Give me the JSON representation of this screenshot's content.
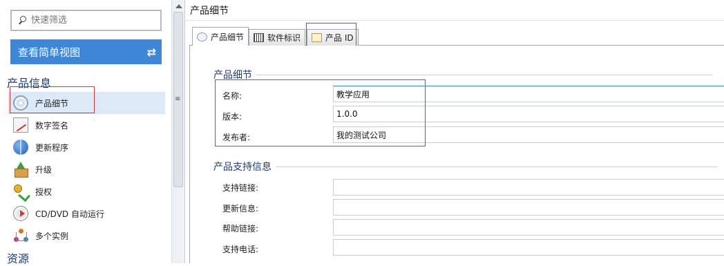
{
  "sidebar": {
    "filter_placeholder": "快速筛选",
    "simple_view_label": "查看简单视图",
    "simple_view_icon": "swap-arrows-icon",
    "section_product_info": "产品信息",
    "section_resources": "资源",
    "items": [
      {
        "label": "产品细节",
        "icon": "disc-gear-icon",
        "active": true
      },
      {
        "label": "数字签名",
        "icon": "signature-icon"
      },
      {
        "label": "更新程序",
        "icon": "globe-update-icon"
      },
      {
        "label": "升级",
        "icon": "upgrade-box-icon"
      },
      {
        "label": "授权",
        "icon": "key-license-icon"
      },
      {
        "label": "CD/DVD 自动运行",
        "icon": "cd-autorun-icon"
      },
      {
        "label": "多个实例",
        "icon": "multiple-instances-icon"
      }
    ]
  },
  "main": {
    "title": "产品细节",
    "tabs": [
      {
        "label": "产品细节",
        "icon": "disc-gear-icon",
        "active": true
      },
      {
        "label": "软件标识",
        "icon": "barcode-icon"
      },
      {
        "label": "产品 ID",
        "icon": "cd-icon"
      }
    ],
    "details_group": {
      "title": "产品细节",
      "fields": [
        {
          "label": "名称:",
          "value": "教学应用"
        },
        {
          "label": "版本:",
          "value": "1.0.0"
        },
        {
          "label": "发布者:",
          "value": "我的测试公司"
        }
      ]
    },
    "support_group": {
      "title": "产品支持信息",
      "fields": [
        {
          "label": "支持链接:",
          "value": ""
        },
        {
          "label": "更新信息:",
          "value": ""
        },
        {
          "label": "帮助链接:",
          "value": ""
        },
        {
          "label": "支持电话:",
          "value": ""
        }
      ]
    }
  },
  "colors": {
    "accent": "#3f86d6",
    "highlight": "#dceaf8",
    "annotation_red": "#e0303a",
    "group_title": "#1f3b6e"
  }
}
